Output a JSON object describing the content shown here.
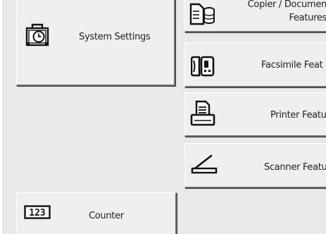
{
  "buttons": {
    "system_settings": {
      "label": "System Settings",
      "icon": "clock-toolbox-icon"
    },
    "copier_document_server": {
      "label_line1": "Copier / Documen",
      "label_line2": "Features",
      "icon": "document-stack-icon"
    },
    "facsimile": {
      "label": "Facsimile Feat",
      "icon": "fax-icon"
    },
    "printer": {
      "label": "Printer Featu",
      "icon": "printer-icon"
    },
    "scanner": {
      "label": "Scanner Featu",
      "icon": "scanner-icon"
    },
    "counter": {
      "label": "Counter",
      "icon_text": "123",
      "icon": "counter-icon"
    }
  }
}
